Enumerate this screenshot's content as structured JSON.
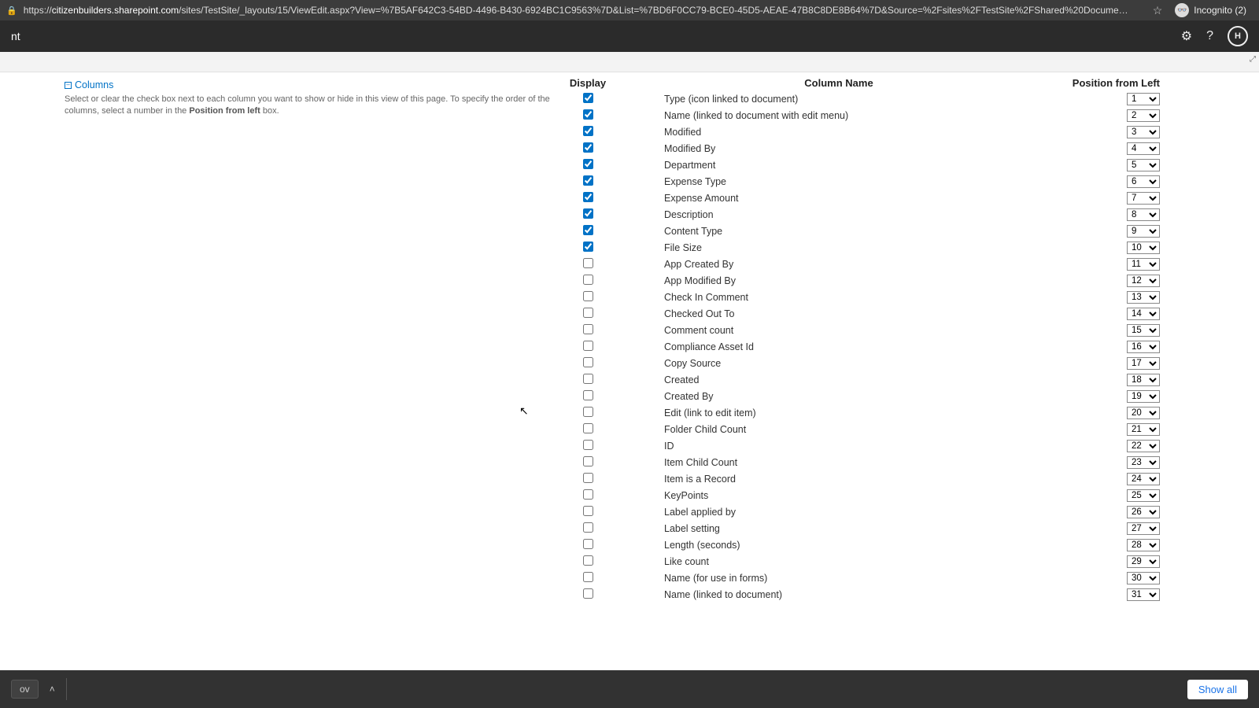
{
  "browser": {
    "url_prefix": "https://",
    "url_domain": "citizenbuilders.sharepoint.com",
    "url_path": "/sites/TestSite/_layouts/15/ViewEdit.aspx?View=%7B5AF642C3-54BD-4496-B430-6924BC1C9563%7D&List=%7BD6F0CC79-BCE0-45D5-AEAE-47B8C8DE8B64%7D&Source=%2Fsites%2FTestSite%2FShared%20Docume…",
    "incognito_label": "Incognito (2)"
  },
  "appbar": {
    "title_fragment": "nt"
  },
  "section": {
    "title": "Columns",
    "description_a": "Select or clear the check box next to each column you want to show or hide in this view of this page. To specify the order of the columns, select a number in the ",
    "description_b": "Position from left",
    "description_c": " box."
  },
  "headers": {
    "display": "Display",
    "name": "Column Name",
    "position": "Position from Left"
  },
  "columns": [
    {
      "label": "Type (icon linked to document)",
      "checked": true,
      "pos": 1
    },
    {
      "label": "Name (linked to document with edit menu)",
      "checked": true,
      "pos": 2
    },
    {
      "label": "Modified",
      "checked": true,
      "pos": 3
    },
    {
      "label": "Modified By",
      "checked": true,
      "pos": 4
    },
    {
      "label": "Department",
      "checked": true,
      "pos": 5
    },
    {
      "label": "Expense Type",
      "checked": true,
      "pos": 6
    },
    {
      "label": "Expense Amount",
      "checked": true,
      "pos": 7
    },
    {
      "label": "Description",
      "checked": true,
      "pos": 8
    },
    {
      "label": "Content Type",
      "checked": true,
      "pos": 9
    },
    {
      "label": "File Size",
      "checked": true,
      "pos": 10
    },
    {
      "label": "App Created By",
      "checked": false,
      "pos": 11
    },
    {
      "label": "App Modified By",
      "checked": false,
      "pos": 12
    },
    {
      "label": "Check In Comment",
      "checked": false,
      "pos": 13
    },
    {
      "label": "Checked Out To",
      "checked": false,
      "pos": 14
    },
    {
      "label": "Comment count",
      "checked": false,
      "pos": 15
    },
    {
      "label": "Compliance Asset Id",
      "checked": false,
      "pos": 16
    },
    {
      "label": "Copy Source",
      "checked": false,
      "pos": 17
    },
    {
      "label": "Created",
      "checked": false,
      "pos": 18
    },
    {
      "label": "Created By",
      "checked": false,
      "pos": 19
    },
    {
      "label": "Edit (link to edit item)",
      "checked": false,
      "pos": 20
    },
    {
      "label": "Folder Child Count",
      "checked": false,
      "pos": 21
    },
    {
      "label": "ID",
      "checked": false,
      "pos": 22
    },
    {
      "label": "Item Child Count",
      "checked": false,
      "pos": 23
    },
    {
      "label": "Item is a Record",
      "checked": false,
      "pos": 24
    },
    {
      "label": "KeyPoints",
      "checked": false,
      "pos": 25
    },
    {
      "label": "Label applied by",
      "checked": false,
      "pos": 26
    },
    {
      "label": "Label setting",
      "checked": false,
      "pos": 27
    },
    {
      "label": "Length (seconds)",
      "checked": false,
      "pos": 28
    },
    {
      "label": "Like count",
      "checked": false,
      "pos": 29
    },
    {
      "label": "Name (for use in forms)",
      "checked": false,
      "pos": 30
    },
    {
      "label": "Name (linked to document)",
      "checked": false,
      "pos": 31
    }
  ],
  "download": {
    "item": "ov",
    "show_all": "Show all"
  }
}
